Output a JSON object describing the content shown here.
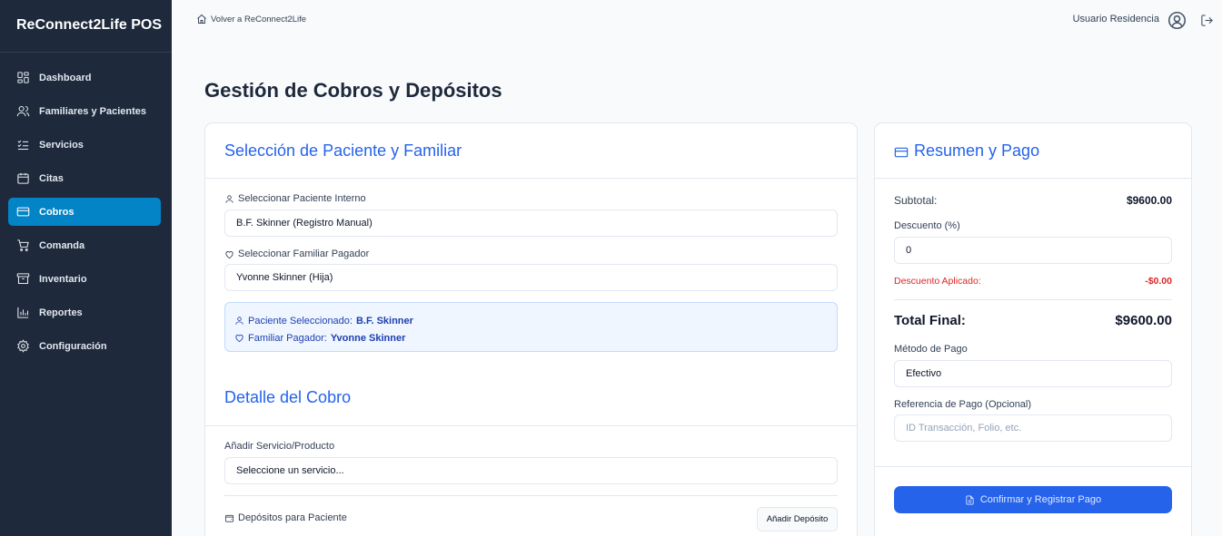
{
  "sidebar": {
    "brand": "ReConnect2Life POS",
    "items": [
      {
        "label": "Dashboard",
        "icon": "dashboard-icon"
      },
      {
        "label": "Familiares y Pacientes",
        "icon": "users-icon"
      },
      {
        "label": "Servicios",
        "icon": "list-check-icon"
      },
      {
        "label": "Citas",
        "icon": "calendar-icon"
      },
      {
        "label": "Cobros",
        "icon": "credit-card-icon",
        "active": true
      },
      {
        "label": "Comanda",
        "icon": "cart-icon"
      },
      {
        "label": "Inventario",
        "icon": "archive-icon"
      },
      {
        "label": "Reportes",
        "icon": "bar-chart-icon"
      },
      {
        "label": "Configuración",
        "icon": "gear-icon"
      }
    ]
  },
  "topbar": {
    "back_label": "Volver a ReConnect2Life",
    "user_name": "Usuario Residencia"
  },
  "page": {
    "title": "Gestión de Cobros y Depósitos"
  },
  "selection": {
    "title": "Selección de Paciente y Familiar",
    "patient_label": "Seleccionar Paciente Interno",
    "patient_value": "B.F. Skinner (Registro Manual)",
    "family_label": "Seleccionar Familiar Pagador",
    "family_value": "Yvonne Skinner (Hija)",
    "info": {
      "patient_prefix": "Paciente Seleccionado:",
      "patient_name": "B.F. Skinner",
      "family_prefix": "Familiar Pagador:",
      "family_name": "Yvonne Skinner"
    }
  },
  "detail": {
    "title": "Detalle del Cobro",
    "add_label": "Añadir Servicio/Producto",
    "add_placeholder": "Seleccione un servicio...",
    "deposits_label": "Depósitos para Paciente",
    "add_deposit_button": "Añadir Depósito"
  },
  "summary": {
    "title": "Resumen y Pago",
    "subtotal_label": "Subtotal:",
    "subtotal_value": "$9600.00",
    "discount_label": "Descuento (%)",
    "discount_value": "0",
    "discount_applied_label": "Descuento Aplicado:",
    "discount_applied_value": "-$0.00",
    "total_label": "Total Final:",
    "total_value": "$9600.00",
    "method_label": "Método de Pago",
    "method_value": "Efectivo",
    "reference_label": "Referencia de Pago (Opcional)",
    "reference_placeholder": "ID Transacción, Folio, etc.",
    "confirm_button": "Confirmar y Registrar Pago"
  },
  "colors": {
    "sidebar_bg": "#1e293b",
    "active_nav": "#0284c7",
    "accent": "#2563eb",
    "danger": "#dc2626"
  }
}
